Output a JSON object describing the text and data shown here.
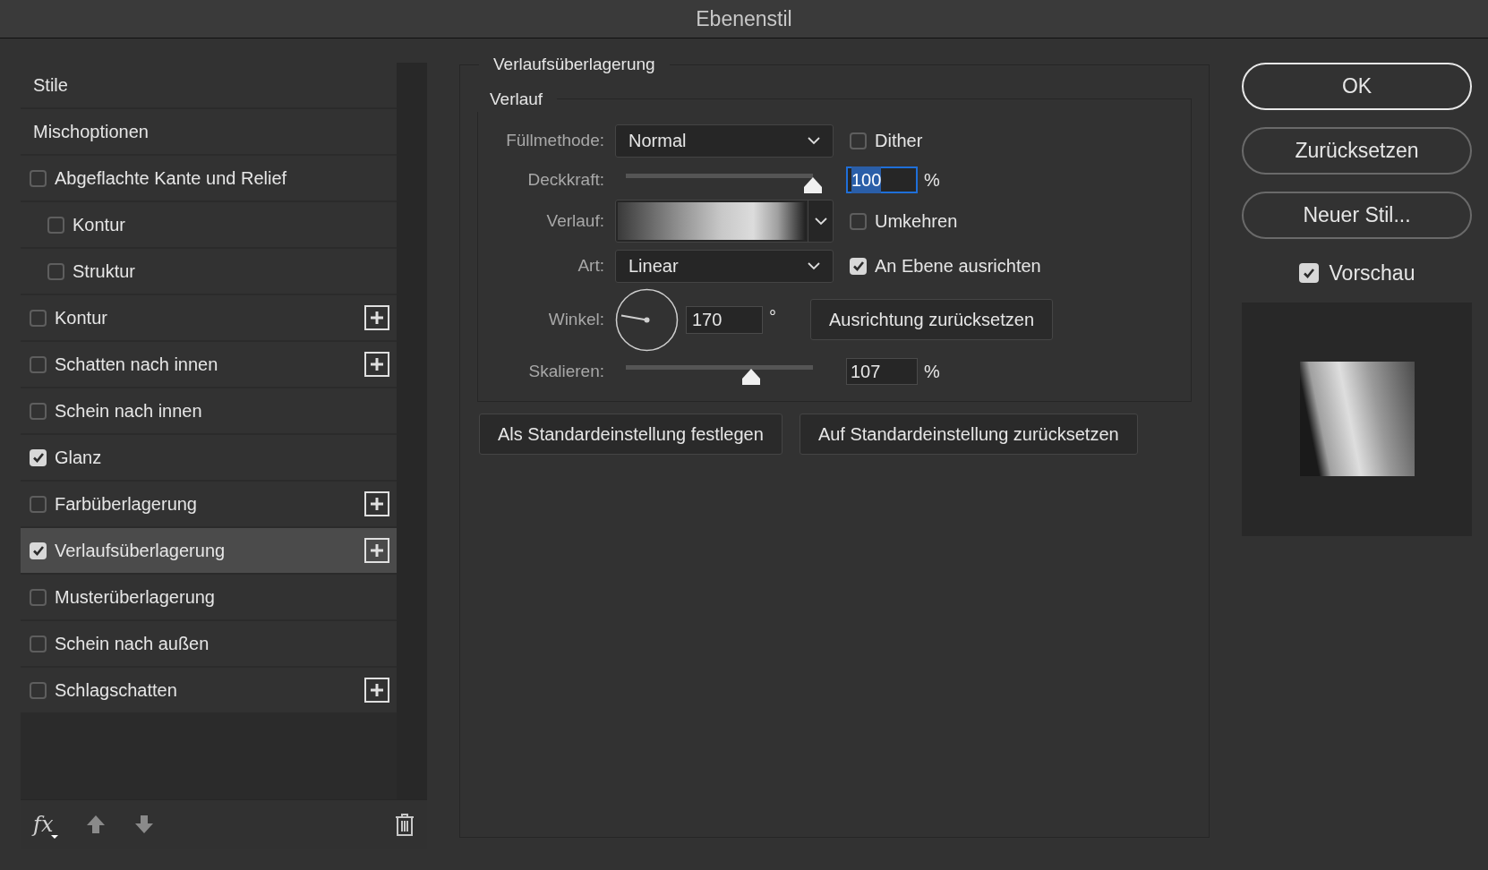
{
  "window": {
    "title": "Ebenenstil"
  },
  "styles": [
    {
      "kind": "header",
      "label": "Stile",
      "selected": false
    },
    {
      "kind": "header",
      "label": "Mischoptionen",
      "selected": false
    },
    {
      "kind": "checkbox",
      "label": "Abgeflachte Kante und Relief",
      "checked": false,
      "selected": false,
      "add_button": false,
      "children": [
        {
          "kind": "checkbox",
          "label": "Kontur",
          "checked": false,
          "selected": false,
          "add_button": false
        },
        {
          "kind": "checkbox",
          "label": "Struktur",
          "checked": false,
          "selected": false,
          "add_button": false
        }
      ]
    },
    {
      "kind": "checkbox",
      "label": "Kontur",
      "checked": false,
      "selected": false,
      "add_button": true
    },
    {
      "kind": "checkbox",
      "label": "Schatten nach innen",
      "checked": false,
      "selected": false,
      "add_button": true
    },
    {
      "kind": "checkbox",
      "label": "Schein nach innen",
      "checked": false,
      "selected": false,
      "add_button": false
    },
    {
      "kind": "checkbox",
      "label": "Glanz",
      "checked": true,
      "selected": false,
      "add_button": false
    },
    {
      "kind": "checkbox",
      "label": "Farbüberlagerung",
      "checked": false,
      "selected": false,
      "add_button": true
    },
    {
      "kind": "checkbox",
      "label": "Verlaufsüberlagerung",
      "checked": true,
      "selected": true,
      "add_button": true
    },
    {
      "kind": "checkbox",
      "label": "Musterüberlagerung",
      "checked": false,
      "selected": false,
      "add_button": false
    },
    {
      "kind": "checkbox",
      "label": "Schein nach außen",
      "checked": false,
      "selected": false,
      "add_button": false
    },
    {
      "kind": "checkbox",
      "label": "Schlagschatten",
      "checked": false,
      "selected": false,
      "add_button": true
    }
  ],
  "styles_toolbar": {
    "fx_label": "fx"
  },
  "panel": {
    "title": "Verlaufsüberlagerung",
    "group_title": "Verlauf",
    "rows": [
      {
        "kind": "select",
        "label": "Füllmethode:",
        "value": "Normal",
        "option": {
          "label": "Dither",
          "checked": false
        }
      },
      {
        "kind": "slider",
        "label": "Deckkraft:",
        "level": 1.0,
        "value": "100",
        "text_selected": true,
        "unit": "%"
      },
      {
        "kind": "gradient",
        "label": "Verlauf:",
        "option": {
          "label": "Umkehren",
          "checked": false
        }
      },
      {
        "kind": "select",
        "label": "Art:",
        "value": "Linear",
        "option": {
          "label": "An Ebene ausrichten",
          "checked": true
        }
      },
      {
        "kind": "angle",
        "label": "Winkel:",
        "value": "170",
        "unit": "°",
        "button": "Ausrichtung zurücksetzen"
      },
      {
        "kind": "slider",
        "label": "Skalieren:",
        "level": 0.67,
        "value": "107",
        "text_selected": false,
        "unit": "%"
      }
    ],
    "buttons": [
      "Als Standardeinstellung festlegen",
      "Auf Standardeinstellung zurücksetzen"
    ]
  },
  "actions": [
    {
      "label": "OK",
      "default": true
    },
    {
      "label": "Zurücksetzen",
      "default": false
    },
    {
      "label": "Neuer Stil...",
      "default": false
    }
  ],
  "preview": {
    "label": "Vorschau",
    "checked": true
  }
}
